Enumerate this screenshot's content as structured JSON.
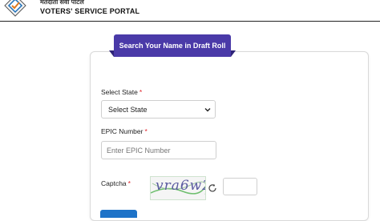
{
  "header": {
    "hindi_text": "मतदाता सेवा पोर्टल",
    "title": "VOTERS' SERVICE PORTAL"
  },
  "form": {
    "tab_title": "Search Your Name in Draft Roll",
    "state": {
      "label": "Select State",
      "required_mark": "*",
      "selected": "Select State"
    },
    "epic": {
      "label": "EPIC Number",
      "required_mark": "*",
      "placeholder": "Enter EPIC Number",
      "value": ""
    },
    "captcha": {
      "label": "Captcha",
      "required_mark": "*",
      "image_text": "vra6w2",
      "value": ""
    }
  },
  "colors": {
    "accent": "#4a3aa8",
    "required": "#e0242c",
    "button": "#1e73c8"
  },
  "icons": [
    "eci-logo-icon",
    "chevron-down-icon",
    "refresh-icon"
  ]
}
